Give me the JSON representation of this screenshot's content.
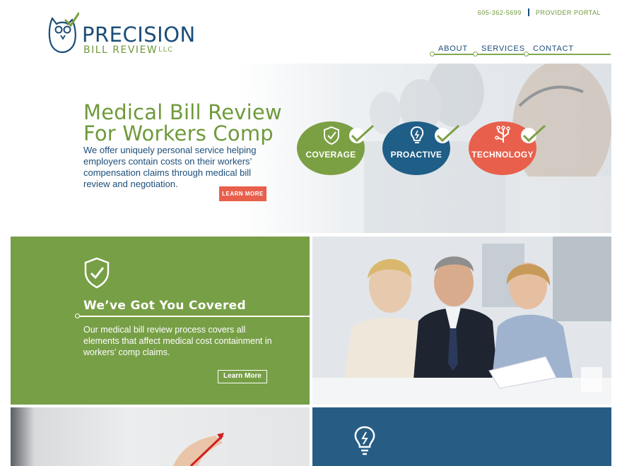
{
  "brand": {
    "name_line1": "PRECISION",
    "name_line2": "BILL REVIEW",
    "suffix": "LLC",
    "primary_color": "#1b4d78",
    "accent_green": "#779f46",
    "accent_coral": "#e8604c"
  },
  "header": {
    "phone": "605-362-5699",
    "provider_portal": "PROVIDER PORTAL",
    "nav": [
      "ABOUT",
      "SERVICES",
      "CONTACT"
    ]
  },
  "hero": {
    "title_line1": "Medical Bill Review",
    "title_line2": "For Workers Comp",
    "lead": "We offer uniquely personal service helping employers contain costs on their workers’ compensation claims through medical bill review and negotiation.",
    "cta": "LEARN MORE",
    "badges": [
      {
        "label": "COVERAGE",
        "icon": "shield-check-icon",
        "color": "#7ba043"
      },
      {
        "label": "PROACTIVE",
        "icon": "lightbulb-icon",
        "color": "#1f5e87"
      },
      {
        "label": "TECHNOLOGY",
        "icon": "circuit-icon",
        "color": "#e8604c"
      }
    ]
  },
  "covered": {
    "icon": "shield-check-icon",
    "title": "We’ve Got You Covered",
    "body": "Our medical bill review process covers all elements that affect medical cost containment in workers’ comp claims.",
    "cta": "Learn More"
  },
  "bottom": {
    "blue_icon": "lightbulb-icon"
  }
}
